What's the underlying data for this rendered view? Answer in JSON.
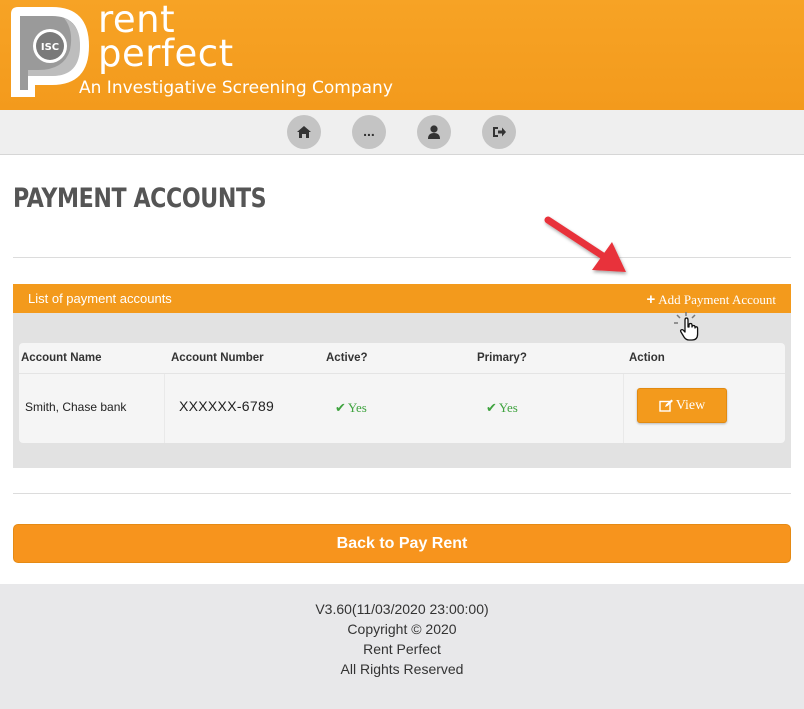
{
  "header": {
    "logo_badge": "ISC",
    "brand_line1": "rent",
    "brand_line2": "perfect",
    "tagline": "An Investigative Screening Company"
  },
  "nav": {
    "items": [
      {
        "name": "home",
        "icon": "home-icon",
        "label": ""
      },
      {
        "name": "more",
        "icon": "ellipsis",
        "label": "..."
      },
      {
        "name": "profile",
        "icon": "user-icon",
        "label": ""
      },
      {
        "name": "logout",
        "icon": "sign-out-icon",
        "label": ""
      }
    ]
  },
  "page": {
    "title": "PAYMENT ACCOUNTS"
  },
  "panel": {
    "title": "List of payment accounts",
    "add_label": "Add Payment Account",
    "add_icon": "plus-icon",
    "accent_color": "#f39a1c"
  },
  "table": {
    "headers": [
      "Account Name",
      "Account Number",
      "Active?",
      "Primary?",
      "Action"
    ],
    "rows": [
      {
        "account_name": "Smith, Chase bank",
        "account_number": "XXXXXX-6789",
        "active": "Yes",
        "primary": "Yes",
        "action_label": "View"
      }
    ]
  },
  "actions": {
    "back_label": "Back to Pay Rent"
  },
  "footer": {
    "version": "V3.60(11/03/2020 23:00:00)",
    "copyright": "Copyright © 2020",
    "company": "Rent Perfect",
    "rights": "All Rights Reserved"
  }
}
